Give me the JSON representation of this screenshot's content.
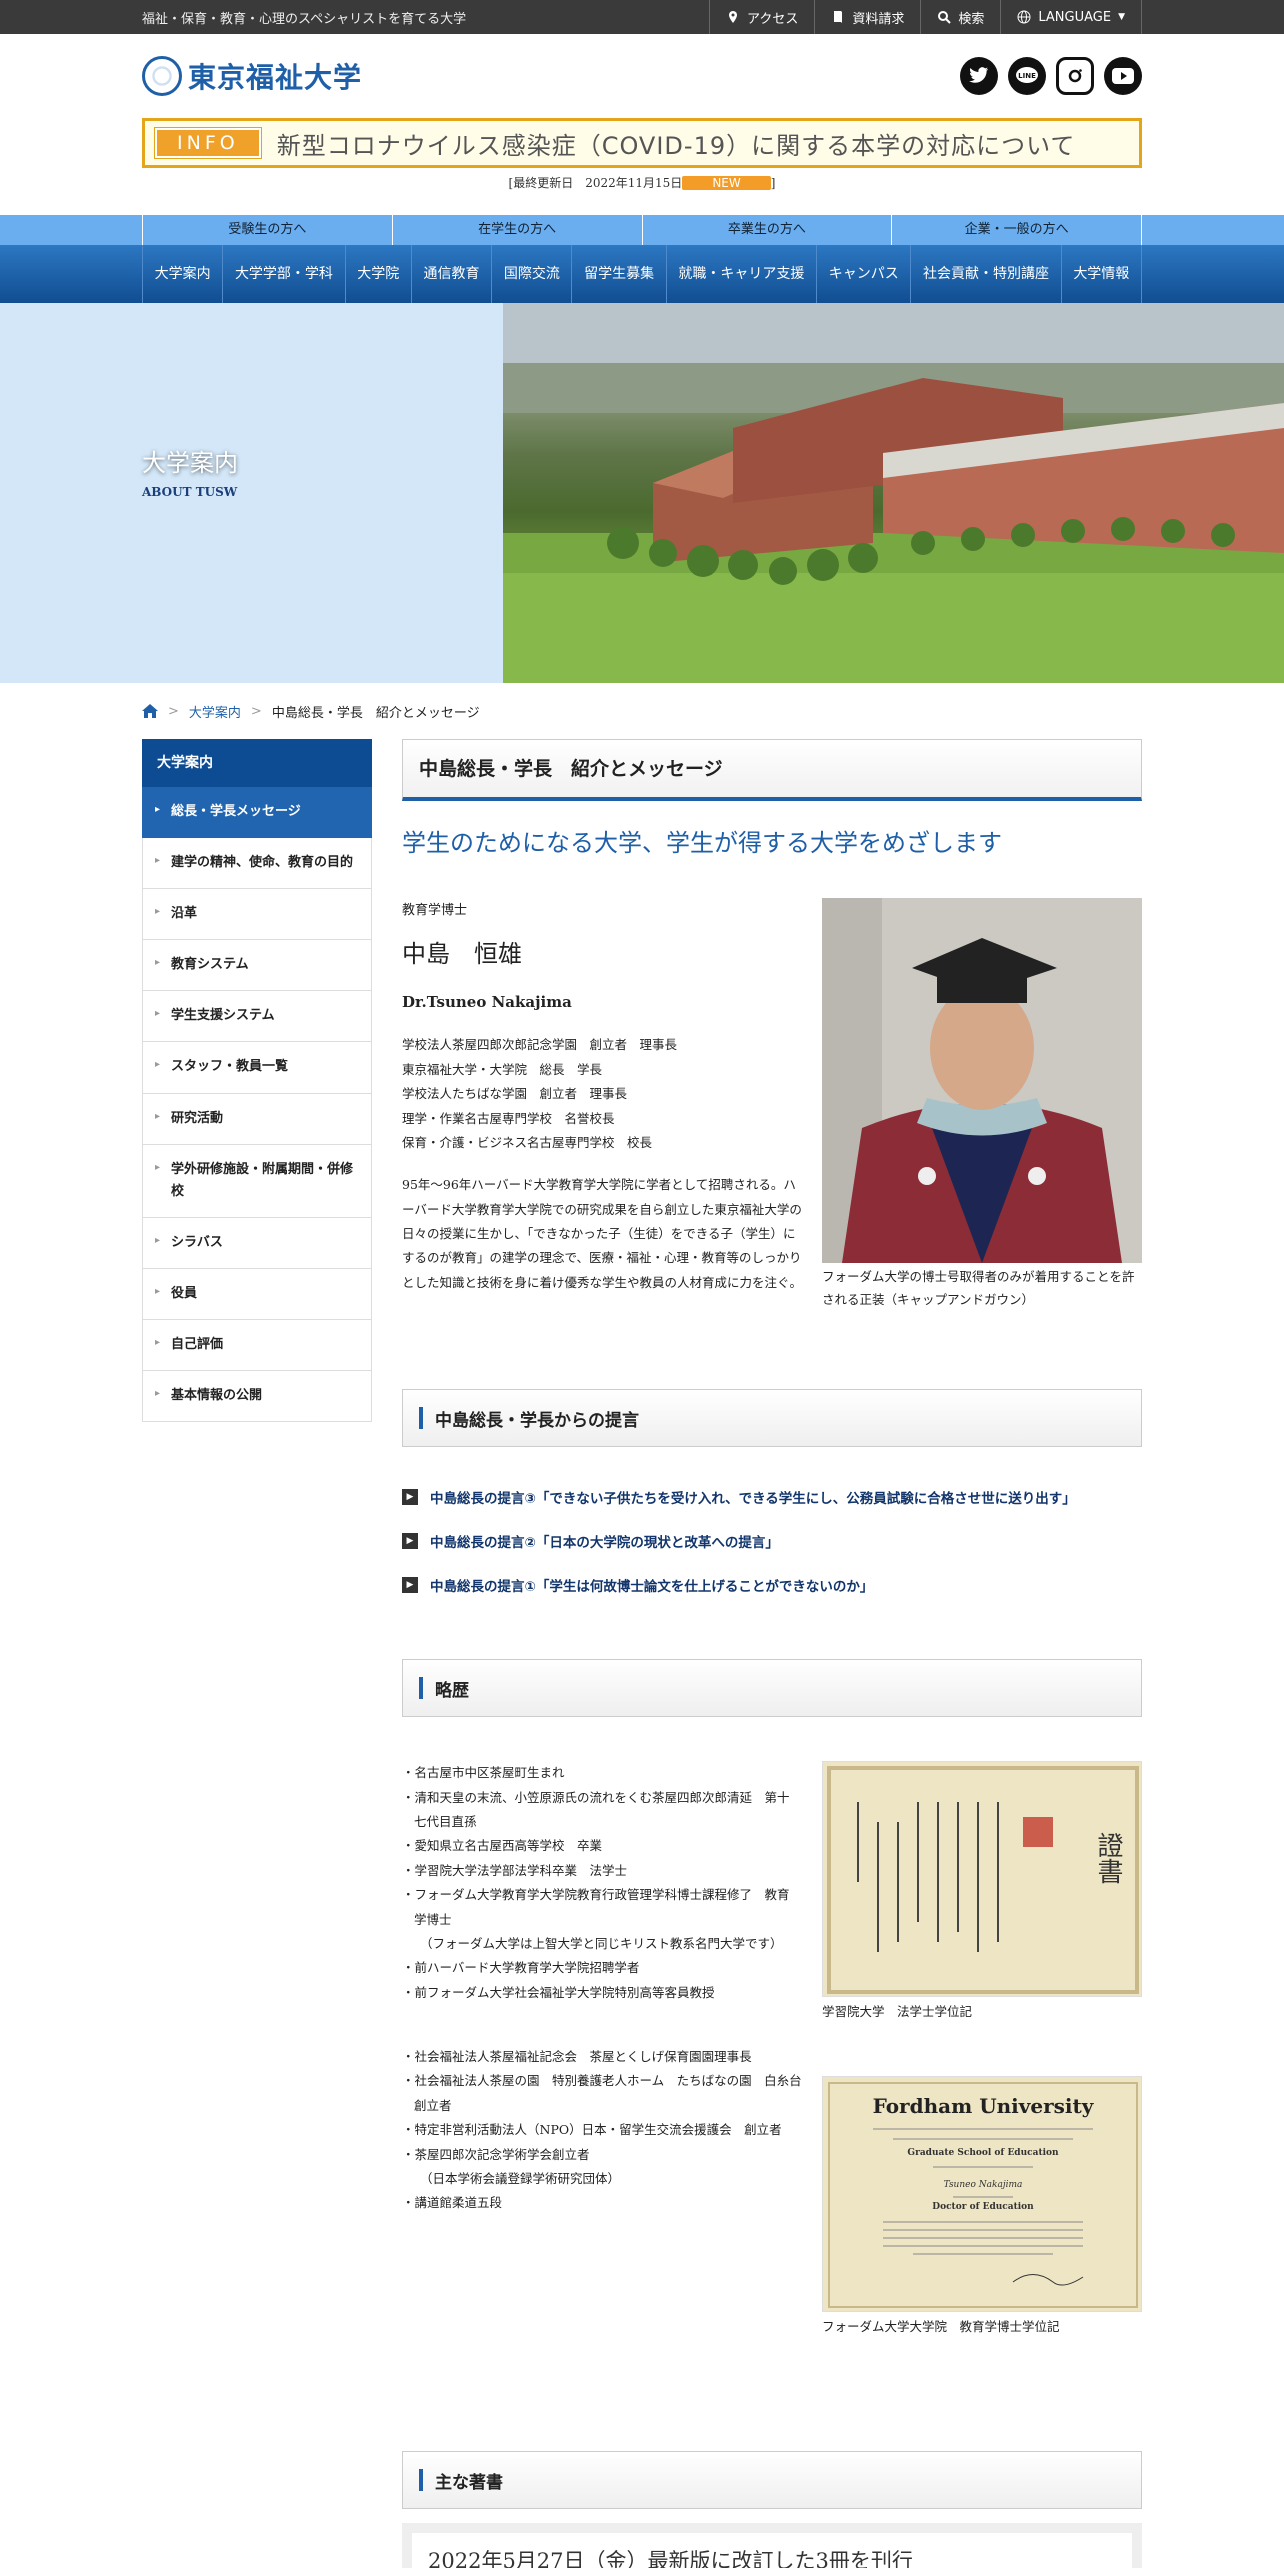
{
  "topbar": {
    "tagline": "福祉・保育・教育・心理のスペシャリストを育てる大学",
    "links": [
      "アクセス",
      "資料請求",
      "検索",
      "LANGUAGE"
    ]
  },
  "header": {
    "logo_text": "東京福祉大学",
    "social": [
      "twitter-icon",
      "line-icon",
      "instagram-icon",
      "youtube-icon"
    ]
  },
  "info": {
    "badge": "INFO",
    "text": "新型コロナウイルス感染症（COVID-19）に関する本学の対応について",
    "updated_prefix": "[最終更新日　2022年11月15日",
    "new_label": "NEW",
    "updated_suffix": "]"
  },
  "audience_nav": [
    "受験生の方へ",
    "在学生の方へ",
    "卒業生の方へ",
    "企業・一般の方へ"
  ],
  "global_nav": [
    "大学案内",
    "大学学部・学科",
    "大学院",
    "通信教育",
    "国際交流",
    "留学生募集",
    "就職・キャリア支援",
    "キャンパス",
    "社会貢献・特別講座",
    "大学情報"
  ],
  "hero": {
    "title": "大学案内",
    "subtitle": "ABOUT TUSW"
  },
  "breadcrumb": {
    "sep": ">",
    "items": [
      "大学案内",
      "中島総長・学長　紹介とメッセージ"
    ]
  },
  "sidebar": {
    "heading": "大学案内",
    "items": [
      "総長・学長メッセージ",
      "建学の精神、使命、教育の目的",
      "沿革",
      "教育システム",
      "学生支援システム",
      "スタッフ・教員一覧",
      "研究活動",
      "学外研修施設・附属期間・併修校",
      "シラバス",
      "役員",
      "自己評価",
      "基本情報の公開"
    ]
  },
  "content": {
    "title": "中島総長・学長　紹介とメッセージ",
    "lead": "学生のためになる大学、学生が得する大学をめざします",
    "degree": "教育学博士",
    "name": "中島　恒雄",
    "en_name": "Dr.Tsuneo Nakajima",
    "roles": [
      "学校法人茶屋四郎次郎記念学園　創立者　理事長",
      "東京福祉大学・大学院　総長　学長",
      "学校法人たちばな学園　創立者　理事長",
      "理学・作業名古屋専門学校　名誉校長",
      "保育・介護・ビジネス名古屋専門学校　校長"
    ],
    "bio": "95年～96年ハーバード大学教育学大学院に学者として招聘される。ハーバード大学教育学大学院での研究成果を自ら創立した東京福祉大学の日々の授業に生かし、「できなかった子（生徒）をできる子（学生）にするのが教育」の建学の理念で、医療・福祉・心理・教育等のしっかりとした知識と技術を身に着け優秀な学生や教員の人材育成に力を注ぐ。",
    "portrait_caption": "フォーダム大学の博士号取得者のみが着用することを許される正装（キャップアンドガウン）",
    "proposals_heading": "中島総長・学長からの提言",
    "proposals": [
      "中島総長の提言③「できない子供たちを受け入れ、できる学生にし、公務員試験に合格させ世に送り出す」",
      "中島総長の提言②「日本の大学院の現状と改革への提言」",
      "中島総長の提言①「学生は何故博士論文を仕上げることができないのか」"
    ],
    "career_heading": "略歴",
    "career_1": [
      "名古屋市中区茶屋町生まれ",
      "清和天皇の末流、小笠原源氏の流れをくむ茶屋四郎次郎清延　第十七代目直孫",
      "愛知県立名古屋西高等学校　卒業",
      "学習院大学法学部法学科卒業　法学士",
      "フォーダム大学教育学大学院教育行政管理学科博士課程修了　教育学博士",
      "前ハーバード大学教育学大学院招聘学者",
      "前フォーダム大学社会福祉学大学院特別高等客員教授"
    ],
    "career_note": "（フォーダム大学は上智大学と同じキリスト教系名門大学です）",
    "career_2": [
      "社会福祉法人茶屋福祉記念会　茶屋とくしげ保育園園理事長",
      "社会福祉法人茶屋の園　特別養護老人ホーム　たちばなの園　白糸台　創立者",
      "特定非営利活動法人（NPO）日本・留学生交流会援護会　創立者",
      "茶屋四郎次記念学術学会創立者",
      "講道館柔道五段"
    ],
    "career_2_note": "（日本学術会議登録学術研究団体）",
    "cert1_caption": "学習院大学　法学士学位記",
    "cert1_title": "證書",
    "cert2_caption": "フォーダム大学大学院　教育学博士学位記",
    "cert2_title": "Fordham University",
    "cert2_lines": [
      "Graduate School of Education",
      "Tsuneo Nakajima",
      "Doctor of Education"
    ],
    "books_heading": "主な著書",
    "books_text": "2022年5月27日（金）最新版に改訂した3冊を刊行"
  }
}
